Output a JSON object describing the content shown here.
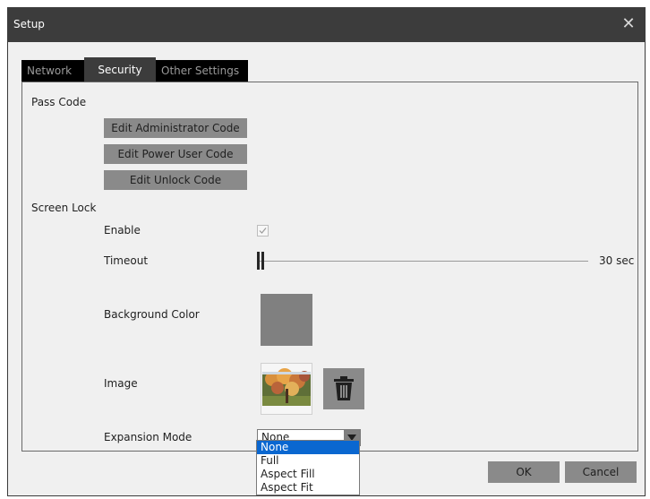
{
  "window": {
    "title": "Setup"
  },
  "tabs": [
    {
      "label": "Network"
    },
    {
      "label": "Security"
    },
    {
      "label": "Other Settings"
    }
  ],
  "active_tab": "Security",
  "pass_code": {
    "section_label": "Pass Code",
    "edit_admin_label": "Edit Administrator Code",
    "edit_power_user_label": "Edit Power User Code",
    "edit_unlock_label": "Edit Unlock Code"
  },
  "screen_lock": {
    "section_label": "Screen Lock",
    "enable_label": "Enable",
    "enable_checked": true,
    "timeout_label": "Timeout",
    "timeout_value": "30 sec",
    "background_color_label": "Background Color",
    "background_color": "#808080",
    "image_label": "Image",
    "expansion_mode_label": "Expansion Mode",
    "expansion_mode_value": "None",
    "expansion_mode_options": [
      "None",
      "Full",
      "Aspect Fill",
      "Aspect Fit"
    ]
  },
  "footer": {
    "ok_label": "OK",
    "cancel_label": "Cancel"
  },
  "icons": {
    "close": "close-icon",
    "checkmark": "checkmark-icon",
    "trash": "trash-icon",
    "dropdown": "chevron-down-icon"
  },
  "colors": {
    "titlebar": "#3c3c3c",
    "button": "#8a8a8a",
    "selected_option": "#0a67d0"
  }
}
